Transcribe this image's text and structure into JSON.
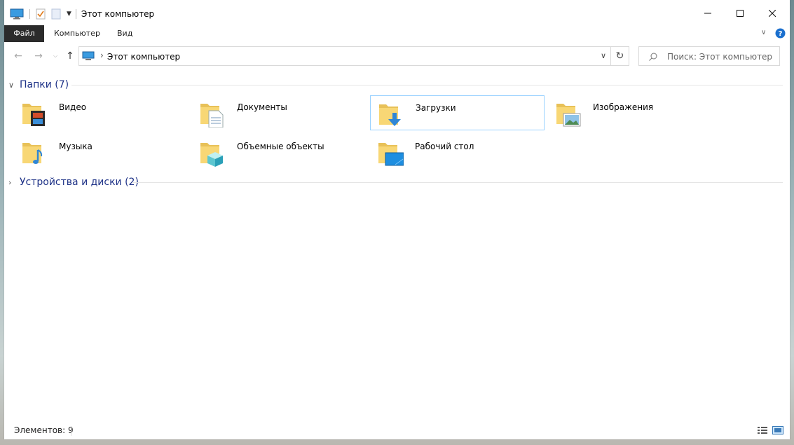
{
  "window": {
    "title": "Этот компьютер",
    "accent": "#1e3287"
  },
  "ribbon": {
    "tabs": [
      {
        "label": "Файл"
      },
      {
        "label": "Компьютер"
      },
      {
        "label": "Вид"
      }
    ]
  },
  "address": {
    "path": "Этот компьютер",
    "search_placeholder": "Поиск: Этот компьютер"
  },
  "groups": {
    "folders": {
      "label": "Папки (7)",
      "items": [
        {
          "name": "Видео",
          "icon": "video-folder-icon"
        },
        {
          "name": "Документы",
          "icon": "documents-folder-icon"
        },
        {
          "name": "Загрузки",
          "icon": "downloads-folder-icon"
        },
        {
          "name": "Изображения",
          "icon": "pictures-folder-icon"
        },
        {
          "name": "Музыка",
          "icon": "music-folder-icon"
        },
        {
          "name": "Объемные объекты",
          "icon": "3d-objects-folder-icon"
        },
        {
          "name": "Рабочий стол",
          "icon": "desktop-folder-icon"
        }
      ]
    },
    "devices": {
      "label": "Устройства и диски (2)"
    }
  },
  "status": {
    "count": "Элементов: 9"
  }
}
